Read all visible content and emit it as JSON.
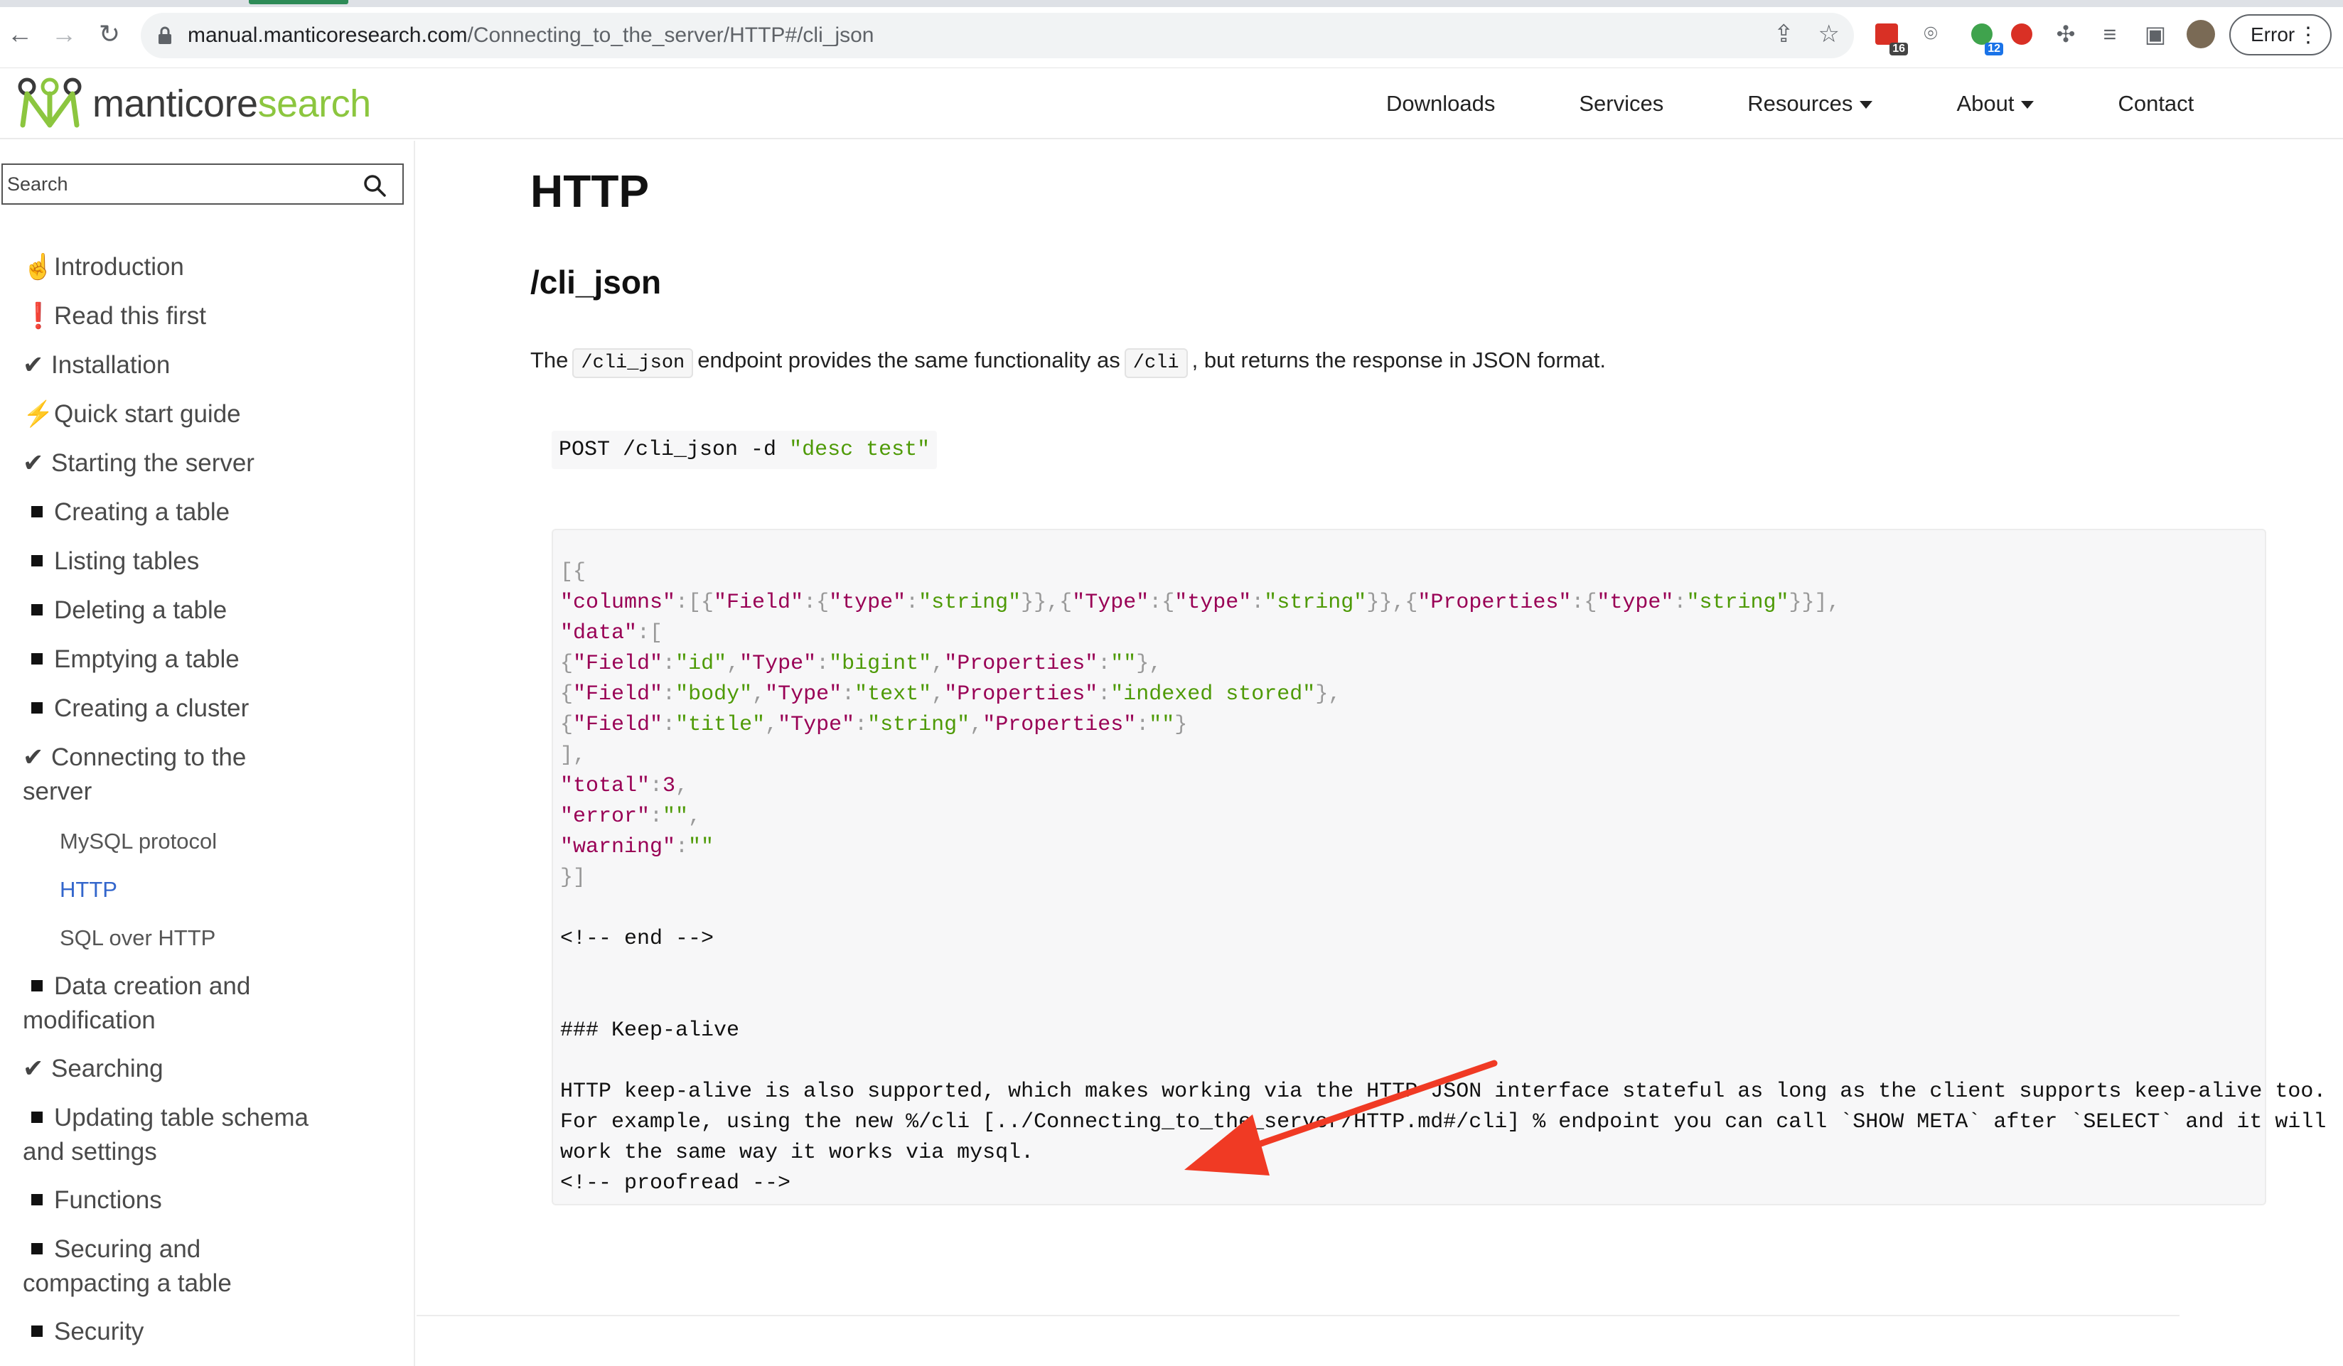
{
  "browser": {
    "url_host": "manual.manticoresearch.com",
    "url_path": "/Connecting_to_the_server/HTTP#/cli_json",
    "ext_badge_1": "16",
    "ext_badge_2": "12",
    "error_label": "Error",
    "icons": [
      "back-icon",
      "forward-icon",
      "reload-icon",
      "lock-icon",
      "share-icon",
      "star-icon",
      "calendar-extension-icon",
      "camera-extension-icon",
      "grammar-extension-icon",
      "red-extension-icon",
      "puzzle-icon",
      "media-queue-icon",
      "side-panel-icon",
      "profile-avatar",
      "kebab-icon"
    ]
  },
  "header": {
    "logo_part1": "manticore",
    "logo_part2": "search",
    "nav": [
      {
        "label": "Downloads"
      },
      {
        "label": "Services"
      },
      {
        "label": "Resources"
      },
      {
        "label": "About"
      },
      {
        "label": "Contact"
      }
    ],
    "colors": {
      "logo_green": "#8cc63f",
      "logo_dark": "#3a3a3a"
    }
  },
  "sidebar": {
    "search_placeholder": "Search",
    "items": [
      {
        "icon": "☝",
        "label": "Introduction"
      },
      {
        "icon": "❗",
        "label": "Read this first"
      },
      {
        "icon": "✔",
        "label": "Installation"
      },
      {
        "icon": "⚡",
        "label": "Quick start guide"
      },
      {
        "icon": "✔",
        "label": "Starting the server"
      },
      {
        "icon": "■",
        "label": "Creating a table"
      },
      {
        "icon": "■",
        "label": "Listing tables"
      },
      {
        "icon": "■",
        "label": "Deleting a table"
      },
      {
        "icon": "■",
        "label": "Emptying a table"
      },
      {
        "icon": "■",
        "label": "Creating a cluster"
      },
      {
        "icon": "✔",
        "label": "Connecting to the",
        "label2": "server"
      },
      {
        "icon": "■",
        "label": "Data creation and",
        "label2": "modification"
      },
      {
        "icon": "✔",
        "label": "Searching"
      },
      {
        "icon": "■",
        "label": "Updating table schema",
        "label2": "and settings"
      },
      {
        "icon": "■",
        "label": "Functions"
      },
      {
        "icon": "■",
        "label": "Securing and",
        "label2": "compacting a table"
      },
      {
        "icon": "■",
        "label": "Security"
      }
    ],
    "subitems": [
      {
        "label": "MySQL protocol"
      },
      {
        "label": "HTTP",
        "active": true
      },
      {
        "label": "SQL over HTTP"
      }
    ],
    "active_color": "#3366cc"
  },
  "content": {
    "h1": "HTTP",
    "h2": "/cli_json",
    "para_pre": "The",
    "para_code1": "/cli_json",
    "para_mid": "endpoint provides the same functionality as",
    "para_code2": "/cli",
    "para_post": ", but returns the response in JSON format.",
    "cmd_main": "POST /cli_json -d ",
    "cmd_str": "\"desc test\"",
    "code_lines": {
      "l1": "[{",
      "l9": "],",
      "l13": "}]",
      "end_marker": "<!-- end -->",
      "keepalive": "### Keep-alive",
      "p1": "HTTP keep-alive is also supported, which makes working via the HTTP JSON interface stateful as long as the client supports keep-alive too.",
      "p2": "For example, using the new %/cli [../Connecting_to_the_server/HTTP.md#/cli] % endpoint you can call `SHOW META` after `SELECT` and it will",
      "p3": "work the same way it works via mysql.",
      "proofread": "<!-- proofread -->"
    },
    "arrow_color": "#f03a24"
  }
}
